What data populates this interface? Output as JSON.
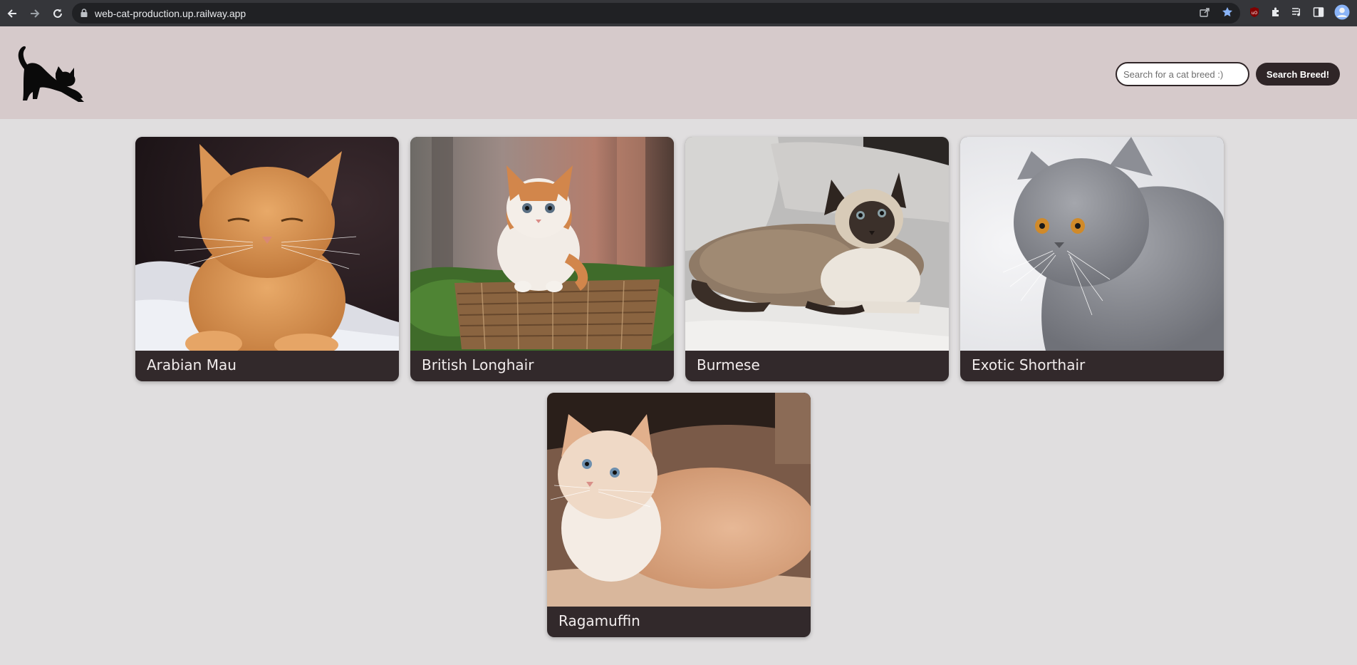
{
  "browser": {
    "url": "web-cat-production.up.railway.app",
    "icons": [
      "back-icon",
      "forward-icon",
      "reload-icon",
      "lock-icon",
      "share-icon",
      "bookmark-star-icon",
      "ublock-icon",
      "extensions-icon",
      "media-control-icon",
      "side-panel-icon",
      "profile-avatar-icon"
    ]
  },
  "header": {
    "logo": "stretching-cat-logo",
    "search": {
      "placeholder": "Search for a cat breed :)",
      "value": "",
      "button_label": "Search Breed!"
    }
  },
  "breeds": [
    {
      "name": "Arabian Mau",
      "image": "orange-tabby-cat-photo"
    },
    {
      "name": "British Longhair",
      "image": "fluffy-kitten-on-basket-photo"
    },
    {
      "name": "Burmese",
      "image": "siamese-style-cat-lying-photo"
    },
    {
      "name": "Exotic Shorthair",
      "image": "grey-flatfaced-cat-photo"
    },
    {
      "name": "Ragamuffin",
      "image": "cream-longhair-cat-photo"
    }
  ],
  "colors": {
    "header_bg": "#d6cacb",
    "page_bg": "#e0dedf",
    "card_footer": "#32292b",
    "button_bg": "#2f2527",
    "button_text": "#ffffff"
  }
}
